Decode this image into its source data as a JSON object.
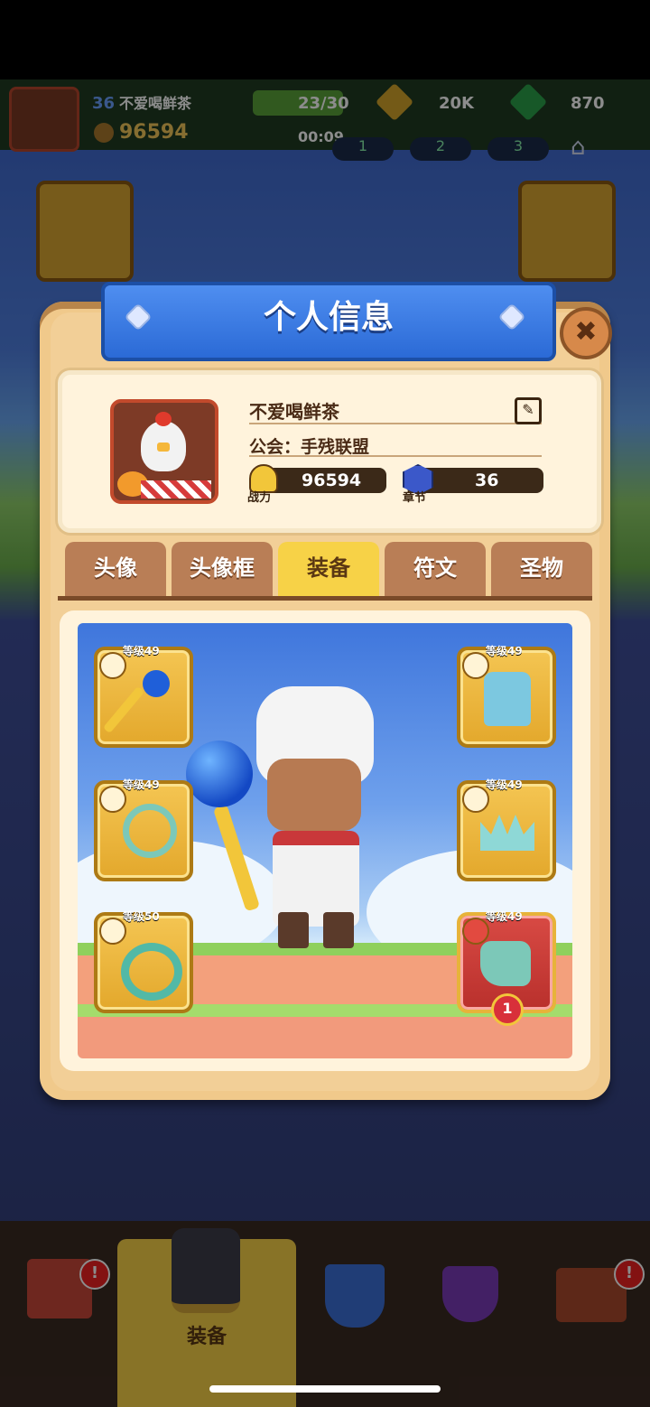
{
  "hud": {
    "player_level": "36",
    "player_name": "不爱喝鲜茶",
    "power": "96594",
    "energy": "23/30",
    "timer": "00:09",
    "gold": "20K",
    "gems": "870",
    "page_tabs": [
      "1",
      "2",
      "3"
    ]
  },
  "modal": {
    "title": "个人信息",
    "close_label": "✖",
    "profile": {
      "name": "不爱喝鲜茶",
      "guild": "公会：手残联盟",
      "power_label": "战力",
      "power_value": "96594",
      "chapter_label": "章节",
      "chapter_value": "36"
    },
    "tabs": [
      "头像",
      "头像框",
      "装备",
      "符文",
      "圣物"
    ],
    "active_tab": "装备",
    "equipment": {
      "slots": [
        {
          "level": "等级49",
          "item": "staff"
        },
        {
          "level": "等级49",
          "item": "armor"
        },
        {
          "level": "等级49",
          "item": "necklace"
        },
        {
          "level": "等级49",
          "item": "crown"
        },
        {
          "level": "等级50",
          "item": "ring"
        },
        {
          "level": "等级49",
          "item": "boots",
          "badge": "1"
        }
      ]
    }
  },
  "bottom_nav": {
    "active_label": "装备",
    "badge": "!"
  },
  "colors": {
    "tab_active": "#f7d247",
    "tab_inactive": "#b97e56",
    "title_banner": "#2b6ad6",
    "modal_bg": "#f0c98b"
  }
}
